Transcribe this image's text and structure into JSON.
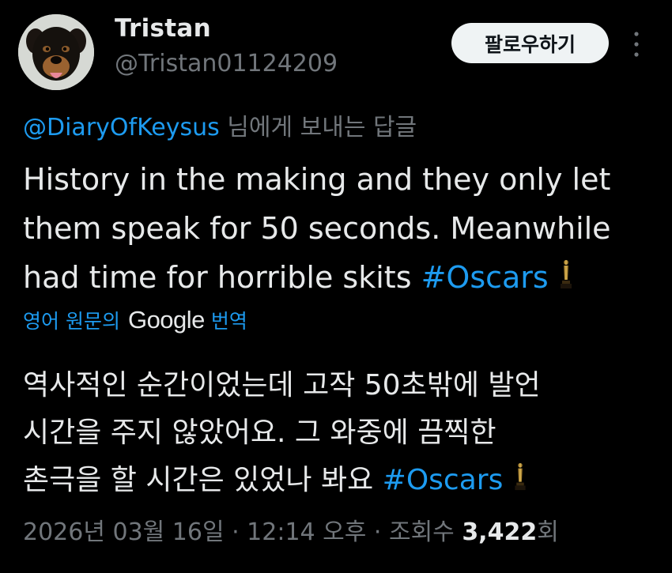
{
  "user": {
    "display_name": "Tristan",
    "handle": "@Tristan01124209",
    "avatar_icon": "rottweiler-avatar"
  },
  "header": {
    "follow_label": "팔로우하기",
    "more_icon": "more-vertical-icon"
  },
  "reply": {
    "mention": "@DiaryOfKeysus",
    "suffix": " 님에게 보내는 답글"
  },
  "tweet": {
    "line1": "History in the making and they only let",
    "line2": "them speak for 50 seconds. Meanwhile",
    "line3": "had time for horrible skits ",
    "hashtag": "#Oscars",
    "emoji_icon": "oscar-trophy-icon"
  },
  "translation": {
    "prefix": "영어 원문의",
    "provider": "Google",
    "suffix": "번역",
    "line1": "역사적인 순간이었는데 고작 50초밖에 발언",
    "line2": "시간을 주지 않았어요. 그 와중에 끔찍한",
    "line3": "촌극을 할 시간은 있었나 봐요 ",
    "hashtag": "#Oscars"
  },
  "meta": {
    "date": "2026년 03월 16일 · 12:14 오후 · 조회수 ",
    "views": "3,422",
    "views_suffix": "회"
  },
  "colors": {
    "background": "#000000",
    "text": "#e7e9ea",
    "secondary": "#71767b",
    "accent": "#1d9bf0",
    "button_bg": "#eff3f4"
  }
}
